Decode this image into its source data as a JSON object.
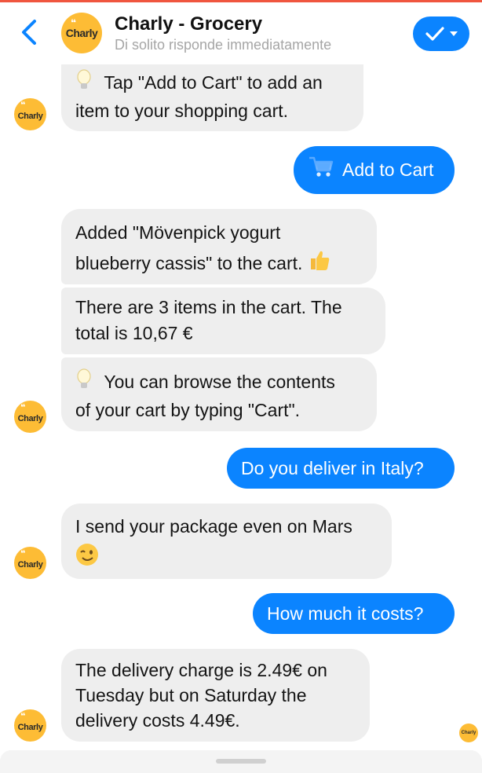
{
  "header": {
    "title": "Charly - Grocery",
    "subtitle": "Di solito risponde immediatamente",
    "avatar_label": "Charly"
  },
  "colors": {
    "accent": "#0b84ff",
    "bot_bubble": "#eeeeee",
    "avatar": "#fdbc35",
    "top_line": "#f0563f"
  },
  "avatar_small_label": "Charly",
  "messages": {
    "m1": {
      "line1": "Tap \"Add to Cart\" to add an",
      "line2": "item to your shopping cart.",
      "icon": "lightbulb"
    },
    "m2": {
      "text": "Add to Cart",
      "icon": "cart"
    },
    "m3": {
      "line1": "Added \"Mövenpick yogurt",
      "line2": "blueberry cassis\" to the cart.",
      "icon": "thumbs-up"
    },
    "m4": {
      "line1": "There are 3 items in the cart. The",
      "line2": "total is 10,67 €"
    },
    "m5": {
      "line1": "You can browse the contents",
      "line2": "of your cart by typing \"Cart\".",
      "icon": "lightbulb"
    },
    "m6": {
      "text": "Do you deliver in Italy?"
    },
    "m7": {
      "line1": "I send your package even on Mars",
      "icon": "winking-face"
    },
    "m8": {
      "text": "How much it costs?"
    },
    "m9": {
      "line1": "The delivery charge is 2.49€ on",
      "line2": "Tuesday but on Saturday the",
      "line3": "delivery costs 4.49€."
    }
  }
}
